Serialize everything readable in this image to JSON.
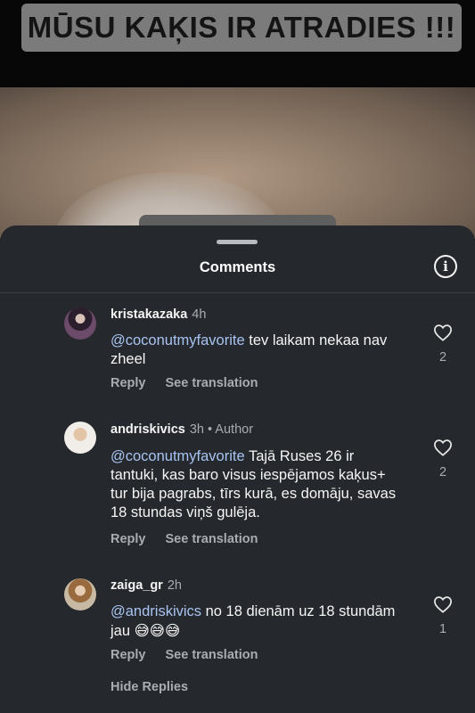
{
  "banner": {
    "text": "MŪSU KAĶIS IR ATRADIES !!!"
  },
  "sheet": {
    "title": "Comments",
    "info_icon": "info-icon",
    "hide_replies": "Hide Replies"
  },
  "comments": [
    {
      "username": "kristakazaka",
      "time": "4h",
      "author_tag": "",
      "mention": "@coconutmyfavorite",
      "text": " tev laikam nekaa nav zheel",
      "emoji": "",
      "reply": "Reply",
      "translate": "See translation",
      "likes": "2"
    },
    {
      "username": "andriskivics",
      "time": "3h",
      "author_tag": " • Author",
      "mention": "@coconutmyfavorite",
      "text": " Tajā Ruses 26 ir tantuki, kas baro visus iespējamos kaķus+ tur bija pagrabs, tīrs  kurā, es domāju, savas 18 stundas viņš gulēja.",
      "emoji": "",
      "reply": "Reply",
      "translate": "See translation",
      "likes": "2"
    },
    {
      "username": "zaiga_gr",
      "time": "2h",
      "author_tag": "",
      "mention": "@andriskivics",
      "text": " no 18 dienām uz 18 stundām jau ",
      "emoji": "😅😅😅",
      "reply": "Reply",
      "translate": "See translation",
      "likes": "1"
    }
  ]
}
